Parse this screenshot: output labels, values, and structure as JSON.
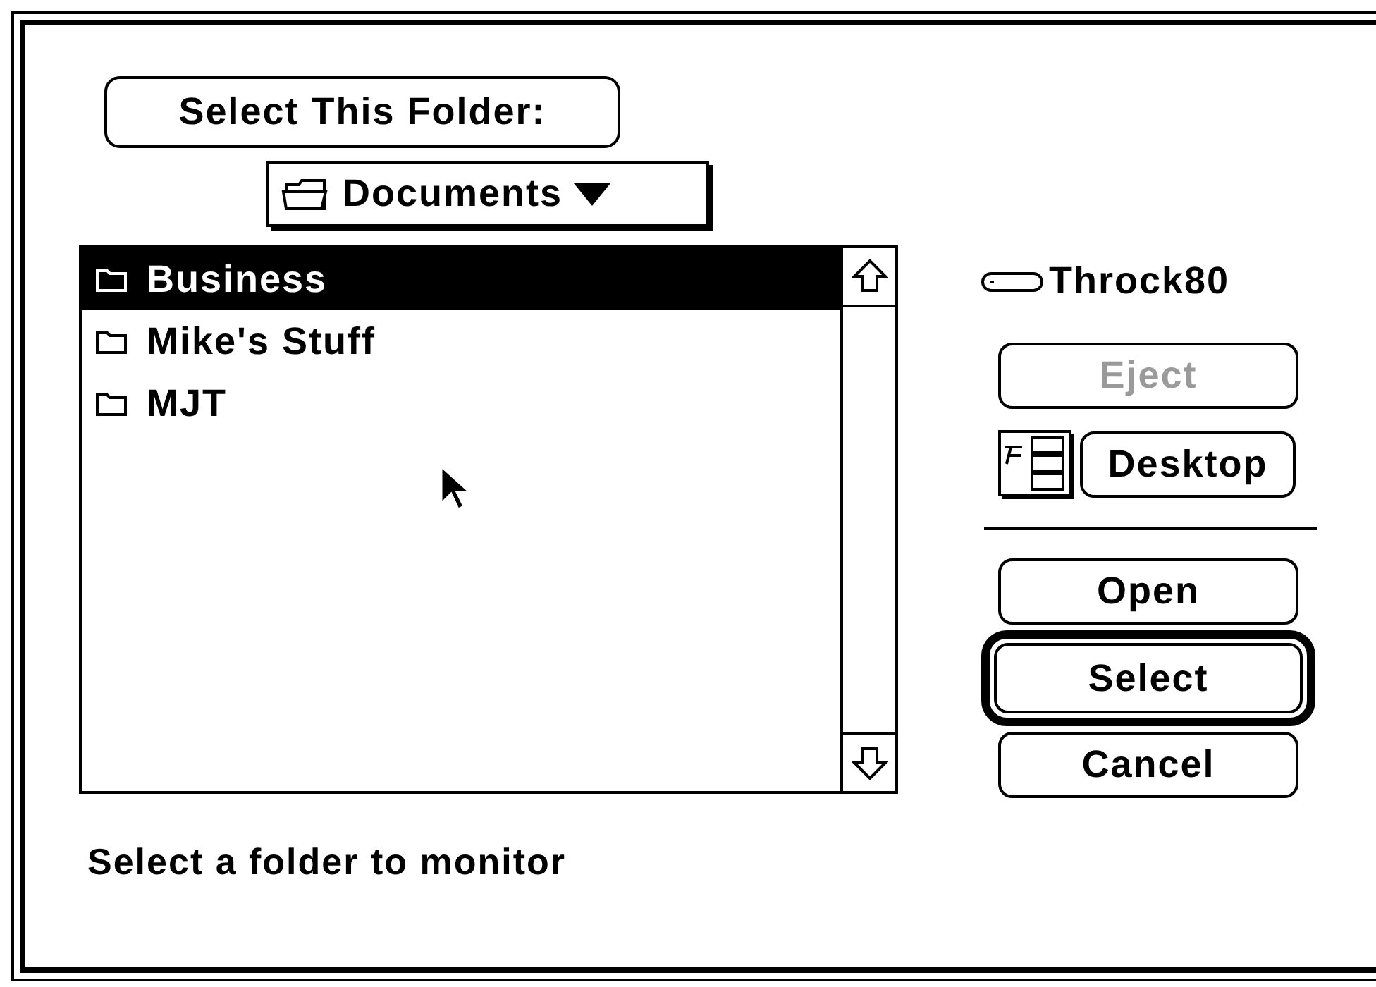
{
  "prompt_button": {
    "label": "Select This Folder:"
  },
  "folder_popup": {
    "label": "Documents"
  },
  "file_list": {
    "items": [
      {
        "name": "Business",
        "selected": true
      },
      {
        "name": "Mike's Stuff",
        "selected": false
      },
      {
        "name": "MJT",
        "selected": false
      }
    ]
  },
  "volume": {
    "name": "Throck80"
  },
  "side_buttons": [
    {
      "kind": "eject",
      "label": "Eject",
      "disabled": true
    },
    {
      "kind": "desktop",
      "label": "Desktop",
      "disabled": false
    }
  ],
  "action_buttons": [
    {
      "label": "Open",
      "default": false
    },
    {
      "label": "Select",
      "default": true
    },
    {
      "label": "Cancel",
      "default": false
    }
  ],
  "status": "Select a folder to monitor"
}
